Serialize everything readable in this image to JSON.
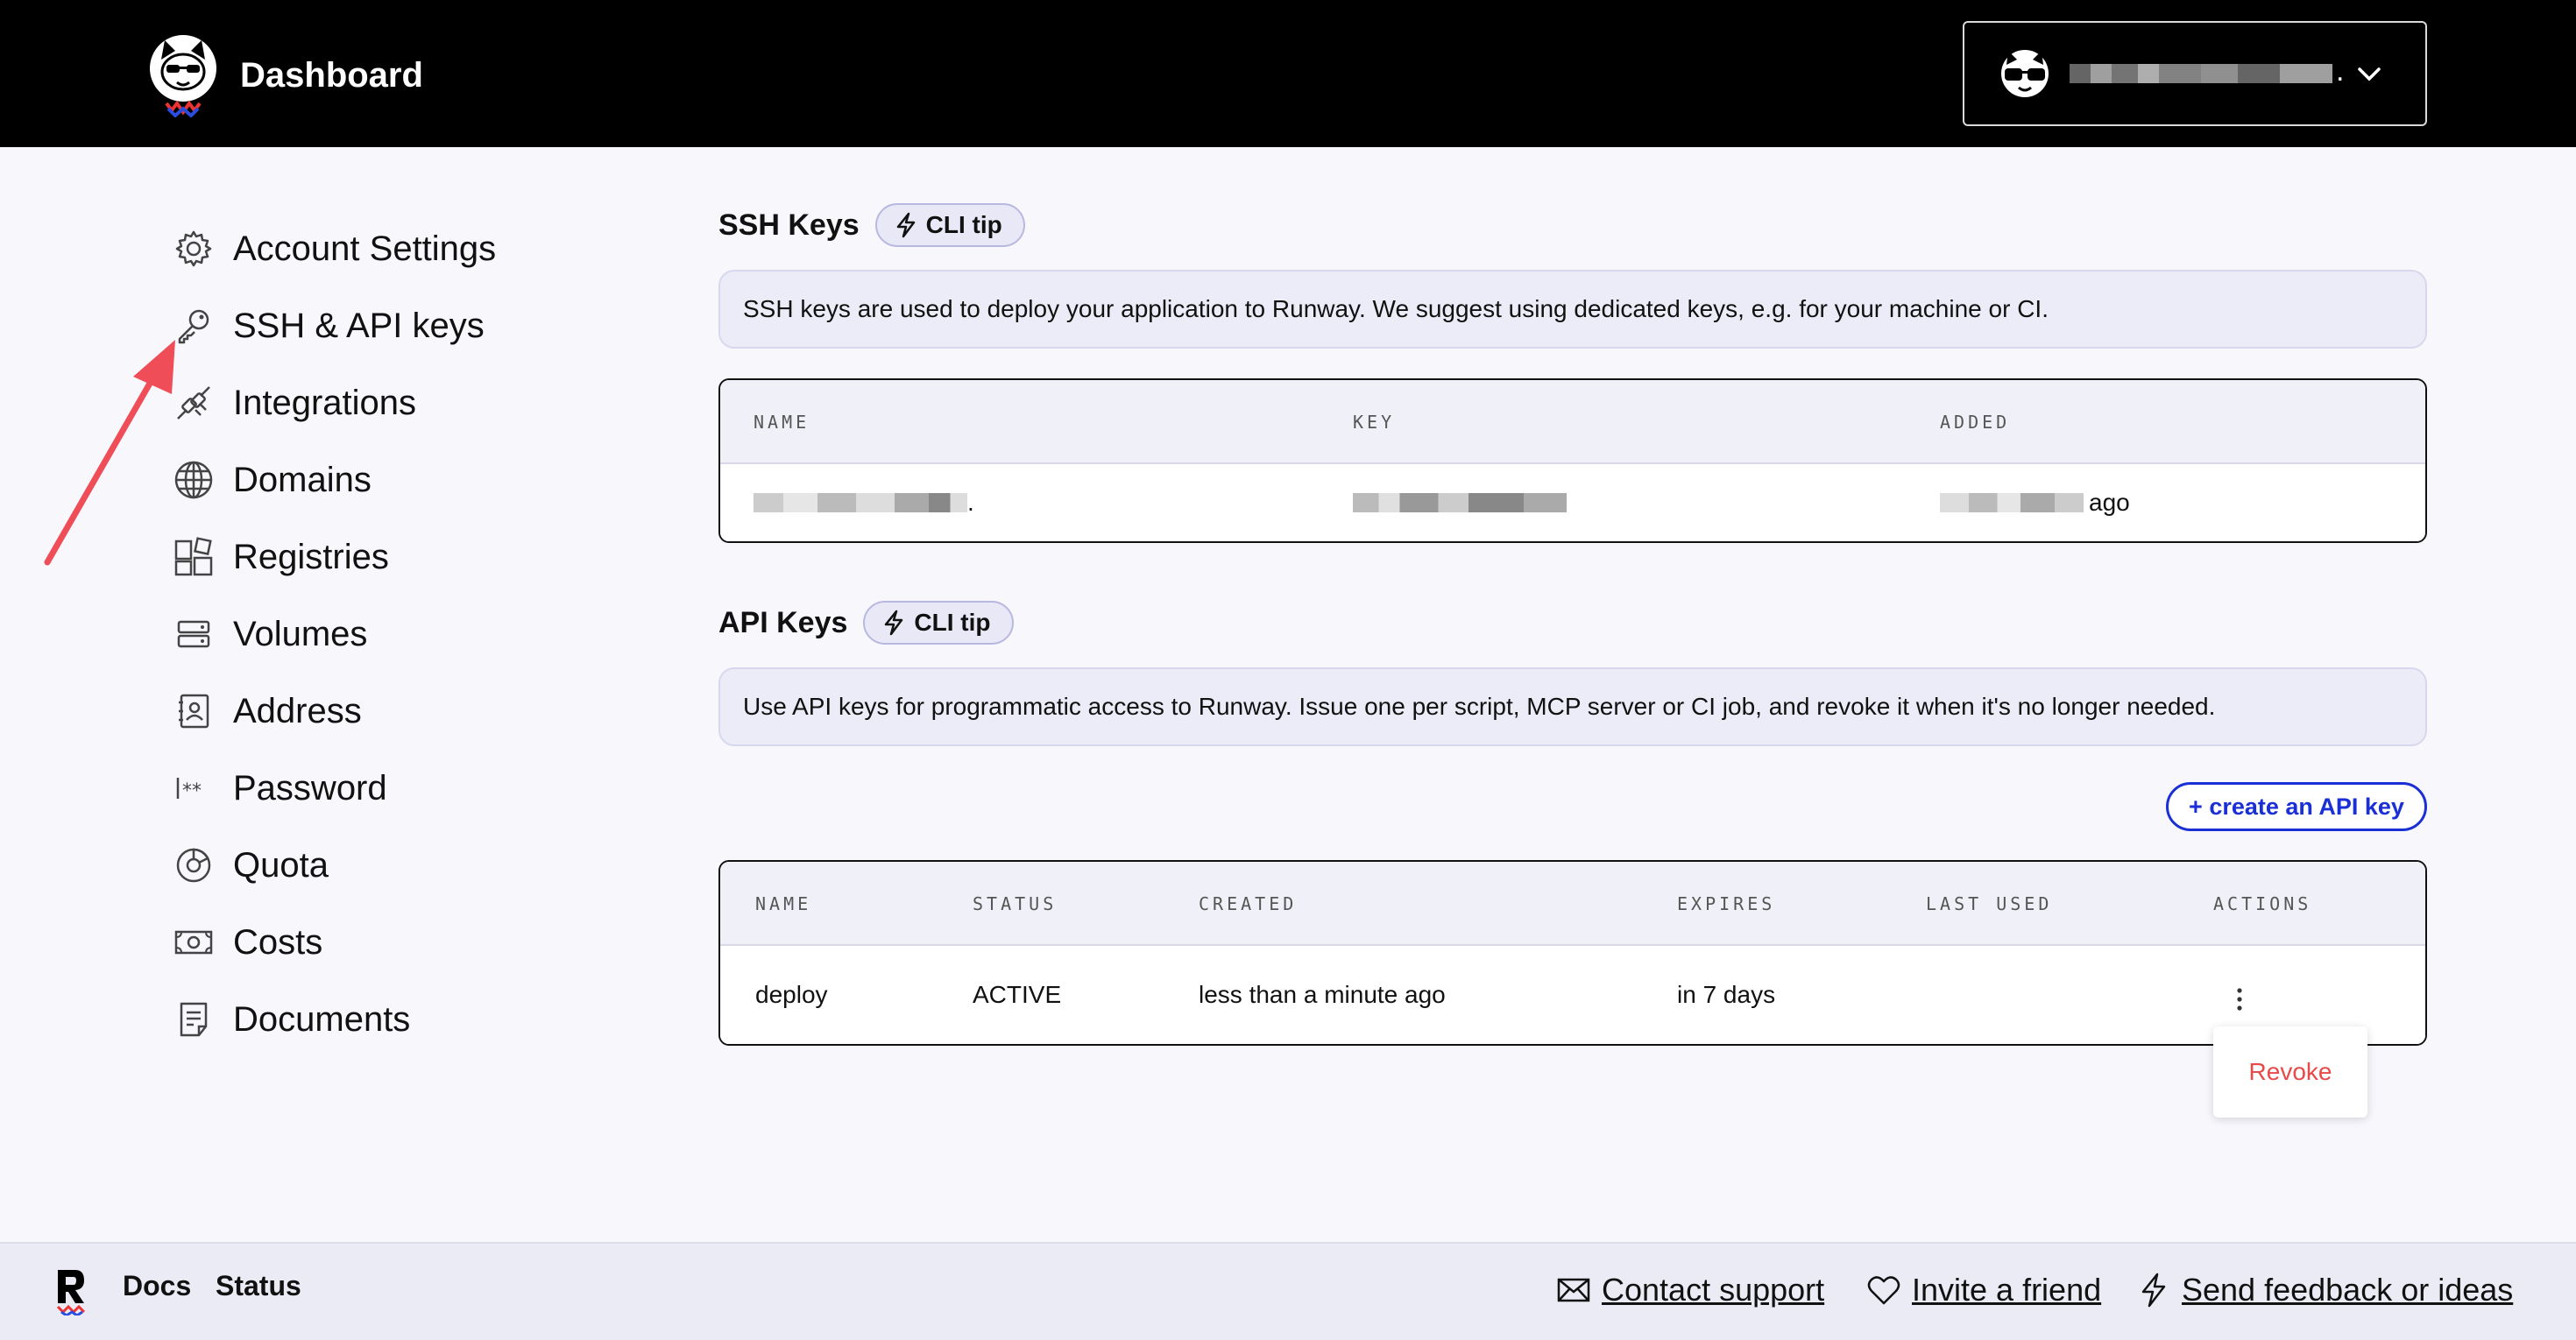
{
  "header": {
    "title": "Dashboard",
    "account_suffix": "."
  },
  "sidebar": {
    "items": [
      {
        "label": "Account Settings",
        "icon": "gear-icon"
      },
      {
        "label": "SSH & API keys",
        "icon": "key-icon"
      },
      {
        "label": "Integrations",
        "icon": "plug-icon"
      },
      {
        "label": "Domains",
        "icon": "globe-icon"
      },
      {
        "label": "Registries",
        "icon": "registry-icon"
      },
      {
        "label": "Volumes",
        "icon": "volume-icon"
      },
      {
        "label": "Address",
        "icon": "address-icon"
      },
      {
        "label": "Password",
        "icon": "password-icon"
      },
      {
        "label": "Quota",
        "icon": "quota-icon"
      },
      {
        "label": "Costs",
        "icon": "cash-icon"
      },
      {
        "label": "Documents",
        "icon": "document-icon"
      }
    ]
  },
  "ssh": {
    "title": "SSH Keys",
    "cli_tip": "CLI tip",
    "info": "SSH keys are used to deploy your application to Runway. We suggest using dedicated keys, e.g. for your machine or CI.",
    "columns": [
      "NAME",
      "KEY",
      "ADDED"
    ],
    "row": {
      "name_suffix": ".",
      "added_suffix": "ago"
    }
  },
  "api": {
    "title": "API Keys",
    "cli_tip": "CLI tip",
    "info": "Use API keys for programmatic access to Runway. Issue one per script, MCP server or CI job, and revoke it when it's no longer needed.",
    "create_label": "+ create an API key",
    "columns": [
      "NAME",
      "STATUS",
      "CREATED",
      "EXPIRES",
      "LAST USED",
      "ACTIONS"
    ],
    "rows": [
      {
        "name": "deploy",
        "status": "ACTIVE",
        "created": "less than a minute ago",
        "expires": "in 7 days",
        "last_used": ""
      }
    ],
    "menu": {
      "revoke": "Revoke"
    }
  },
  "footer": {
    "docs": "Docs",
    "status": "Status",
    "contact": "Contact support",
    "invite": "Invite a friend",
    "feedback": "Send feedback or ideas"
  },
  "colors": {
    "accent": "#1a2fd6",
    "danger": "#e84a4a",
    "annotation": "#ef4d57"
  }
}
